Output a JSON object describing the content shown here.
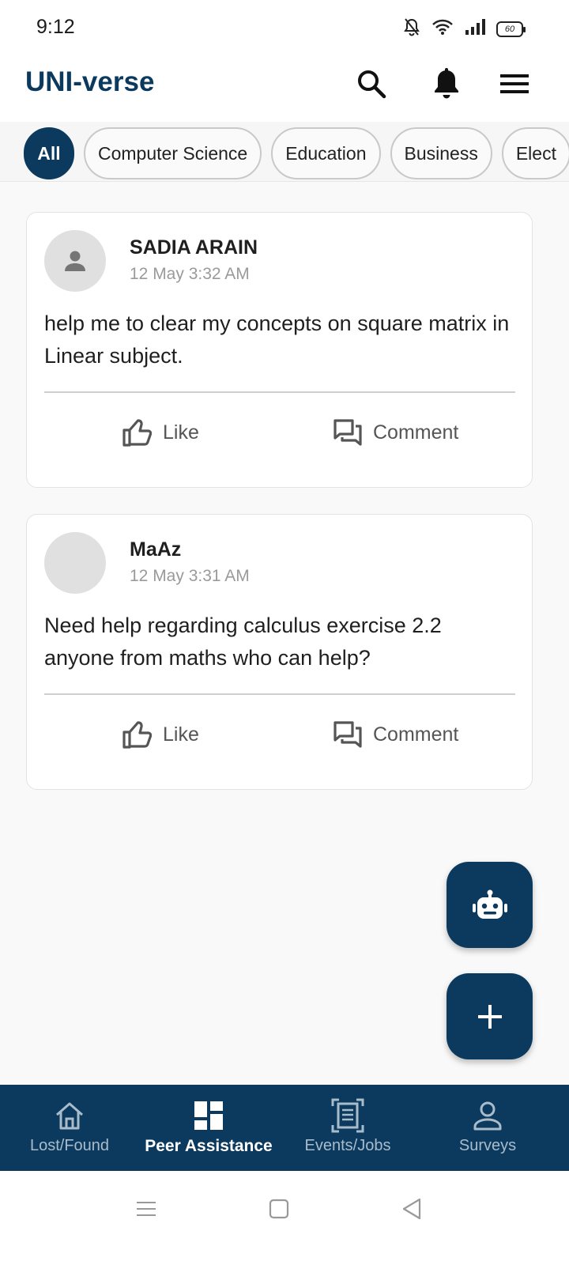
{
  "status_bar": {
    "time": "9:12",
    "battery": "60",
    "icons": [
      "bell-muted-icon",
      "wifi-icon",
      "signal-icon",
      "battery-icon"
    ]
  },
  "app_bar": {
    "title": "UNI-verse",
    "actions": [
      "search-icon",
      "bell-icon",
      "menu-icon"
    ]
  },
  "categories": {
    "items": [
      {
        "label": "All",
        "active": true
      },
      {
        "label": "Computer Science",
        "active": false
      },
      {
        "label": "Education",
        "active": false
      },
      {
        "label": "Business",
        "active": false
      },
      {
        "label": "Elect",
        "active": false
      }
    ]
  },
  "posts": [
    {
      "author": "SADIA ARAIN",
      "time": "12 May 3:32 AM",
      "body": "help me to clear my concepts on  square matrix in Linear subject.",
      "like_label": "Like",
      "comment_label": "Comment"
    },
    {
      "author": "MaAz",
      "time": "12 May 3:31 AM",
      "body": "Need help regarding calculus exercise 2.2 anyone from maths who can help?",
      "like_label": "Like",
      "comment_label": "Comment"
    }
  ],
  "fabs": [
    "robot-icon",
    "plus-icon"
  ],
  "bottom_nav": {
    "items": [
      {
        "label": "Lost/Found",
        "icon": "home-icon",
        "active": false
      },
      {
        "label": "Peer Assistance",
        "icon": "dashboard-icon",
        "active": true
      },
      {
        "label": "Events/Jobs",
        "icon": "document-icon",
        "active": false
      },
      {
        "label": "Surveys",
        "icon": "person-icon",
        "active": false
      }
    ]
  },
  "colors": {
    "brand": "#0b3a5e",
    "background": "#f9f9f9"
  }
}
